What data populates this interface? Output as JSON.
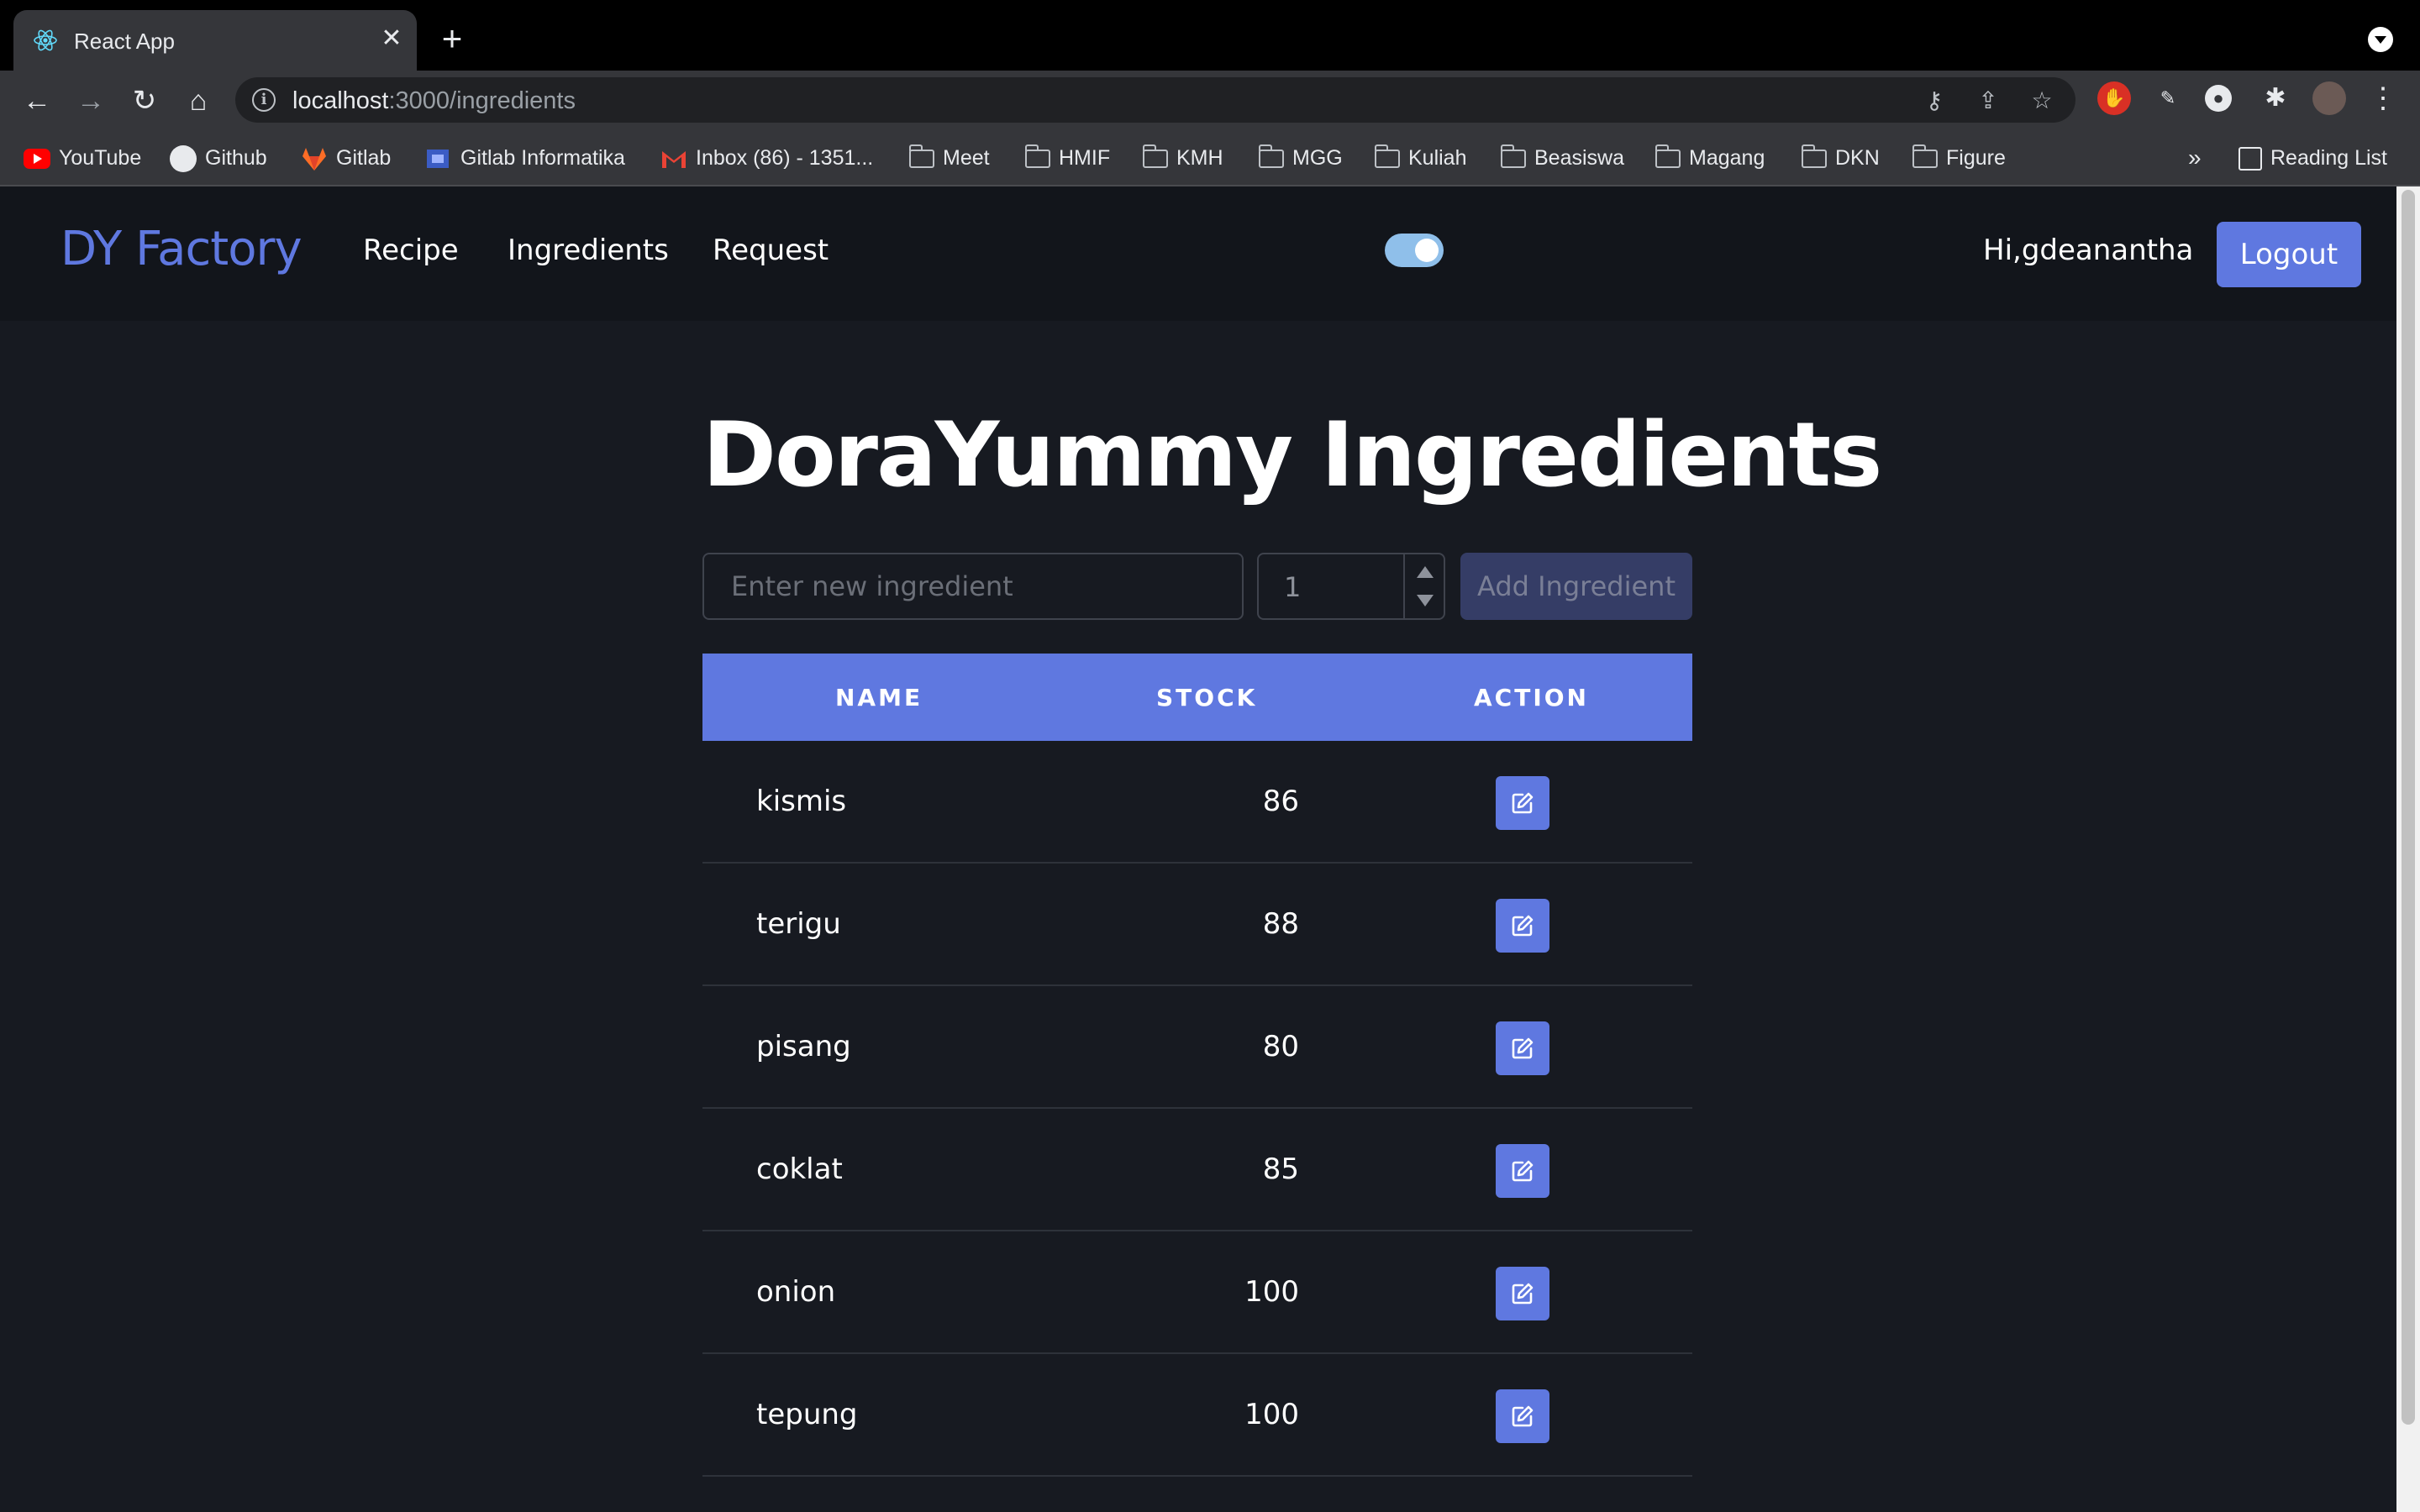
{
  "browser": {
    "tab_title": "React App",
    "tab_close": "✕",
    "new_tab": "+",
    "url_host": "localhost",
    "url_path": ":3000/ingredients",
    "bookmarks": [
      {
        "label": "YouTube",
        "icon": "youtube-icon"
      },
      {
        "label": "Github",
        "icon": "github-icon"
      },
      {
        "label": "Gitlab",
        "icon": "gitlab-icon"
      },
      {
        "label": "Gitlab Informatika",
        "icon": "gitlab-informatika-icon"
      },
      {
        "label": "Inbox (86) - 1351...",
        "icon": "gmail-icon"
      },
      {
        "label": "Meet",
        "icon": "folder-icon"
      },
      {
        "label": "HMIF",
        "icon": "folder-icon"
      },
      {
        "label": "KMH",
        "icon": "folder-icon"
      },
      {
        "label": "MGG",
        "icon": "folder-icon"
      },
      {
        "label": "Kuliah",
        "icon": "folder-icon"
      },
      {
        "label": "Beasiswa",
        "icon": "folder-icon"
      },
      {
        "label": "Magang",
        "icon": "folder-icon"
      },
      {
        "label": "DKN",
        "icon": "folder-icon"
      },
      {
        "label": "Figure",
        "icon": "folder-icon"
      }
    ],
    "more_bookmarks": "»",
    "reading_list": "Reading List"
  },
  "navbar": {
    "brand": "DY Factory",
    "links": [
      "Recipe",
      "Ingredients",
      "Request"
    ],
    "theme_toggle_on": true,
    "greeting": "Hi,gdeanantha",
    "logout_label": "Logout"
  },
  "main": {
    "title": "DoraYummy Ingredients",
    "ingredient_placeholder": "Enter new ingredient",
    "quantity_value": "1",
    "add_label": "Add Ingredient"
  },
  "table": {
    "headers": [
      "NAME",
      "STOCK",
      "ACTION"
    ],
    "rows": [
      {
        "name": "kismis",
        "stock": "86"
      },
      {
        "name": "terigu",
        "stock": "88"
      },
      {
        "name": "pisang",
        "stock": "80"
      },
      {
        "name": "coklat",
        "stock": "85"
      },
      {
        "name": "onion",
        "stock": "100"
      },
      {
        "name": "tepung",
        "stock": "100"
      }
    ]
  },
  "colors": {
    "accent": "#5f78e0",
    "page_bg": "#171a21",
    "navbar_bg": "#12151b",
    "toggle": "#8fbfea"
  }
}
